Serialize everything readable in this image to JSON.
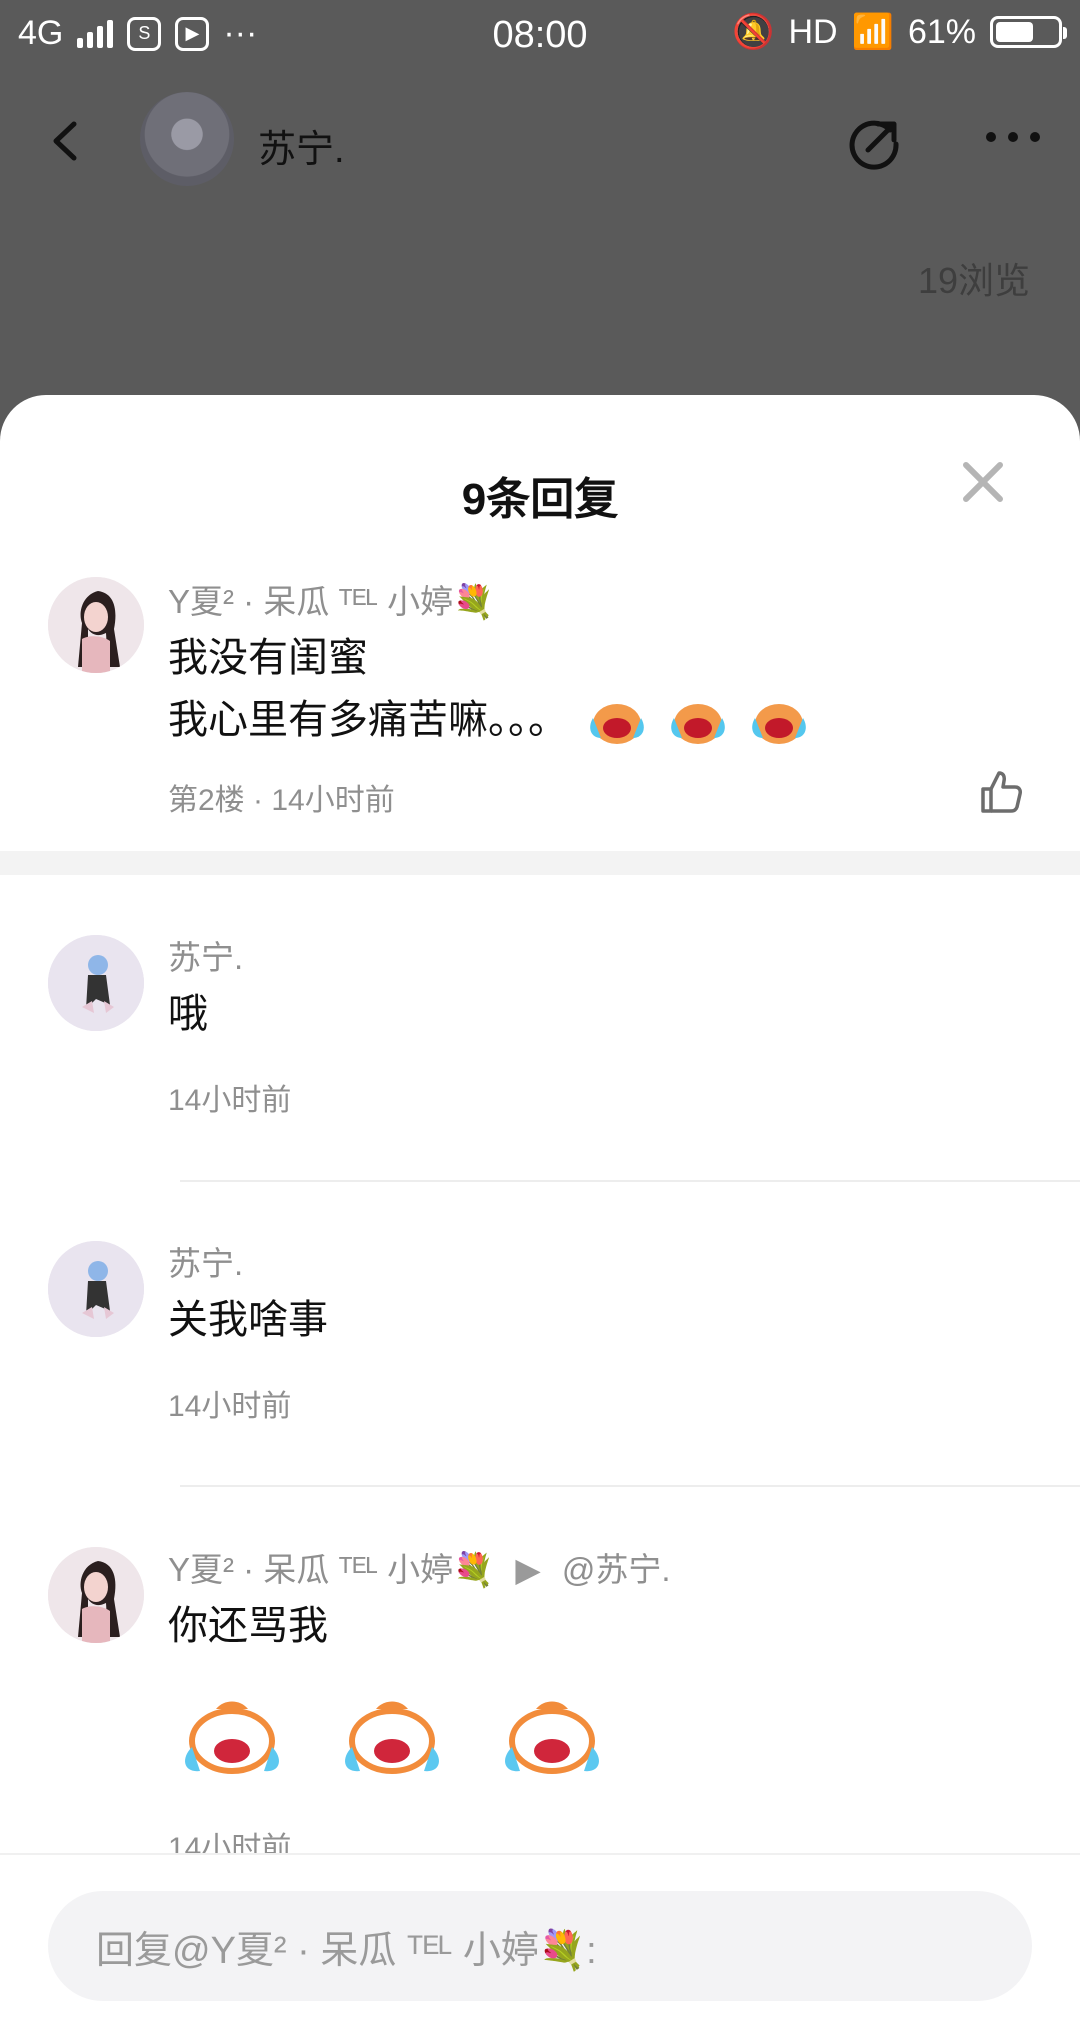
{
  "status_bar": {
    "network": "4G",
    "time": "08:00",
    "hd": "HD",
    "battery": "61%"
  },
  "header": {
    "back_icon": "chevron-left-icon",
    "username": "苏宁.",
    "share_icon": "share-icon",
    "more_icon": "more-icon",
    "views": "19浏览"
  },
  "sheet": {
    "title": "9条回复",
    "close_icon": "close-icon"
  },
  "comments": [
    {
      "author": "Y夏² · 呆瓜 ᵀᴱᴸ 小婷💐",
      "lines": [
        "我没有闺蜜",
        "我心里有多痛苦嘛。。。"
      ],
      "floor_time": "第2楼 · 14小时前",
      "emoji": "crying-emoji"
    },
    {
      "author": "苏宁.",
      "lines": [
        "哦"
      ],
      "time": "14小时前"
    },
    {
      "author": "苏宁.",
      "lines": [
        "关我啥事"
      ],
      "time": "14小时前"
    },
    {
      "author": "Y夏² · 呆瓜 ᵀᴱᴸ 小婷💐",
      "reply_to": "@苏宁.",
      "lines": [
        "你还骂我"
      ],
      "time": "14小时前",
      "stickers": [
        "crying-sticker",
        "crying-sticker",
        "crying-sticker"
      ]
    }
  ],
  "reply_input": {
    "placeholder": "回复@Y夏² · 呆瓜 ᵀᴱᴸ 小婷💐:"
  }
}
